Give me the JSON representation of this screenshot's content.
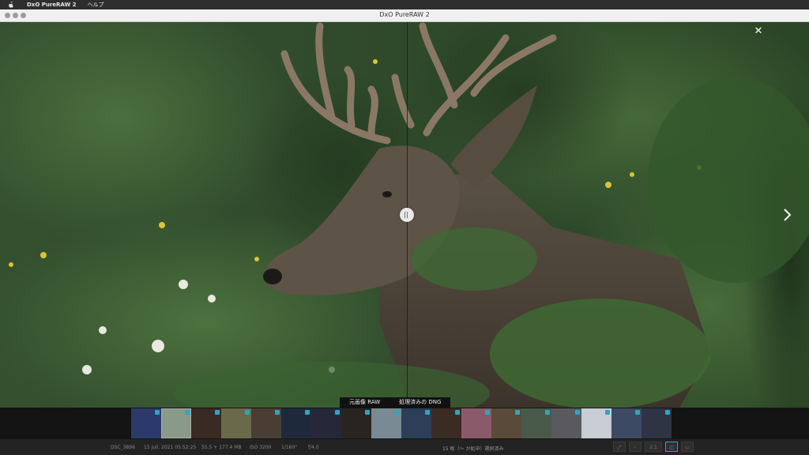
{
  "menubar": {
    "app": "DxO PureRAW 2",
    "menu_help": "ヘルプ"
  },
  "window": {
    "title": "DxO PureRAW 2"
  },
  "viewer": {
    "close_glyph": "✕",
    "compare_labels": {
      "original": "元画像 RAW",
      "processed": "処理済みの DNG"
    }
  },
  "filmstrip": {
    "thumbnails": [
      {
        "checked": true,
        "color": "#2b3a6a"
      },
      {
        "checked": true,
        "color": "#8a9a88"
      },
      {
        "checked": true,
        "color": "#3a2a24"
      },
      {
        "checked": true,
        "color": "#6a6a4a"
      },
      {
        "checked": true,
        "color": "#4a3e34"
      },
      {
        "checked": true,
        "color": "#1e2a3c"
      },
      {
        "checked": true,
        "color": "#26283a"
      },
      {
        "checked": true,
        "color": "#2a2420"
      },
      {
        "checked": true,
        "color": "#7a8a94"
      },
      {
        "checked": true,
        "color": "#2c3e58"
      },
      {
        "checked": true,
        "color": "#3a2c22"
      },
      {
        "checked": true,
        "color": "#8a5a6a"
      },
      {
        "checked": true,
        "color": "#5a4a3a"
      },
      {
        "checked": true,
        "color": "#4a5a4a"
      },
      {
        "checked": true,
        "color": "#5a5a5e"
      },
      {
        "checked": true,
        "color": "#c8ccd4"
      },
      {
        "checked": true,
        "color": "#3c4a64"
      },
      {
        "checked": true,
        "color": "#2e3444"
      }
    ]
  },
  "status": {
    "filename": "DSC_3896",
    "date": "15 juil. 2021 05:52:25",
    "filesize": "55.5 + 177.4 MB",
    "iso": "ISO 3200",
    "shutter": "1/160\"",
    "aperture": "f/4.0",
    "selection": "15 枚（〜 か処中）選択済み",
    "zoom": "2:1"
  },
  "colors": {
    "accent": "#2aa7c4"
  }
}
